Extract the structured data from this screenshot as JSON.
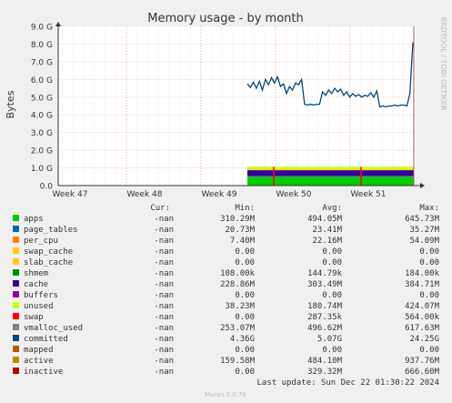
{
  "chart_data": {
    "type": "area",
    "title": "Memory usage - by month",
    "ylabel": "Bytes",
    "watermark": "RRDTOOL / TOBI OETIKER",
    "ylim": [
      0,
      9000000000
    ],
    "yticks": [
      "0.0",
      "1.0 G",
      "2.0 G",
      "3.0 G",
      "4.0 G",
      "5.0 G",
      "6.0 G",
      "7.0 G",
      "8.0 G",
      "9.0 G"
    ],
    "xticks": [
      "Week 47",
      "Week 48",
      "Week 49",
      "Week 50",
      "Week 51"
    ],
    "committed_series_gb": [
      5.75,
      5.55,
      5.85,
      5.5,
      5.9,
      5.4,
      6.0,
      5.7,
      6.1,
      5.8,
      6.15,
      5.6,
      5.75,
      5.2,
      5.6,
      5.4,
      5.8,
      5.7,
      6.0,
      4.6,
      4.55,
      4.6,
      4.55,
      4.6,
      4.6,
      5.3,
      5.1,
      5.4,
      5.2,
      5.5,
      5.3,
      5.45,
      5.1,
      5.3,
      5.0,
      5.2,
      5.05,
      5.15,
      5.0,
      5.1,
      5.05,
      5.25,
      5.0,
      5.35,
      4.45,
      4.5,
      4.45,
      4.5,
      4.5,
      4.55,
      4.5,
      4.55,
      4.55,
      4.5,
      5.2,
      8.1
    ],
    "stack_colors": [
      "#00cc00",
      "#0066b3",
      "#ff8000",
      "#ffcc00",
      "#330099",
      "#990099",
      "#ccff00",
      "#ff0000",
      "#808080",
      "#008f00"
    ],
    "header": {
      "cur": "Cur:",
      "min": "Min:",
      "avg": "Avg:",
      "max": "Max:"
    },
    "legend": [
      {
        "name": "apps",
        "color": "#00cc00",
        "cur": "-nan",
        "min": "310.29M",
        "avg": "494.05M",
        "max": "645.73M"
      },
      {
        "name": "page_tables",
        "color": "#0066b3",
        "cur": "-nan",
        "min": "20.73M",
        "avg": "23.41M",
        "max": "35.27M"
      },
      {
        "name": "per_cpu",
        "color": "#ff8000",
        "cur": "-nan",
        "min": "7.40M",
        "avg": "22.16M",
        "max": "54.09M"
      },
      {
        "name": "swap_cache",
        "color": "#ffcc00",
        "cur": "-nan",
        "min": "0.00",
        "avg": "0.00",
        "max": "0.00"
      },
      {
        "name": "slab_cache",
        "color": "#ffcc00",
        "cur": "-nan",
        "min": "0.00",
        "avg": "0.00",
        "max": "0.00"
      },
      {
        "name": "shmem",
        "color": "#008f00",
        "cur": "-nan",
        "min": "108.00k",
        "avg": "144.79k",
        "max": "184.00k"
      },
      {
        "name": "cache",
        "color": "#330099",
        "cur": "-nan",
        "min": "228.86M",
        "avg": "303.49M",
        "max": "384.71M"
      },
      {
        "name": "buffers",
        "color": "#990099",
        "cur": "-nan",
        "min": "0.00",
        "avg": "0.00",
        "max": "0.00"
      },
      {
        "name": "unused",
        "color": "#ccff00",
        "cur": "-nan",
        "min": "38.23M",
        "avg": "180.74M",
        "max": "424.07M"
      },
      {
        "name": "swap",
        "color": "#ff0000",
        "cur": "-nan",
        "min": "0.00",
        "avg": "287.35k",
        "max": "564.00k"
      },
      {
        "name": "vmalloc_used",
        "color": "#808080",
        "cur": "-nan",
        "min": "253.07M",
        "avg": "496.62M",
        "max": "617.63M"
      },
      {
        "name": "committed",
        "color": "#00487d",
        "cur": "-nan",
        "min": "4.36G",
        "avg": "5.07G",
        "max": "24.25G"
      },
      {
        "name": "mapped",
        "color": "#b35a00",
        "cur": "-nan",
        "min": "0.00",
        "avg": "0.00",
        "max": "0.00"
      },
      {
        "name": "active",
        "color": "#b38f00",
        "cur": "-nan",
        "min": "159.58M",
        "avg": "484.10M",
        "max": "937.76M"
      },
      {
        "name": "inactive",
        "color": "#b30000",
        "cur": "-nan",
        "min": "0.00",
        "avg": "329.32M",
        "max": "666.60M"
      }
    ],
    "last_update": "Last update: Sun Dec 22 01:30:22 2024",
    "footer": "Munin 2.0.76"
  }
}
